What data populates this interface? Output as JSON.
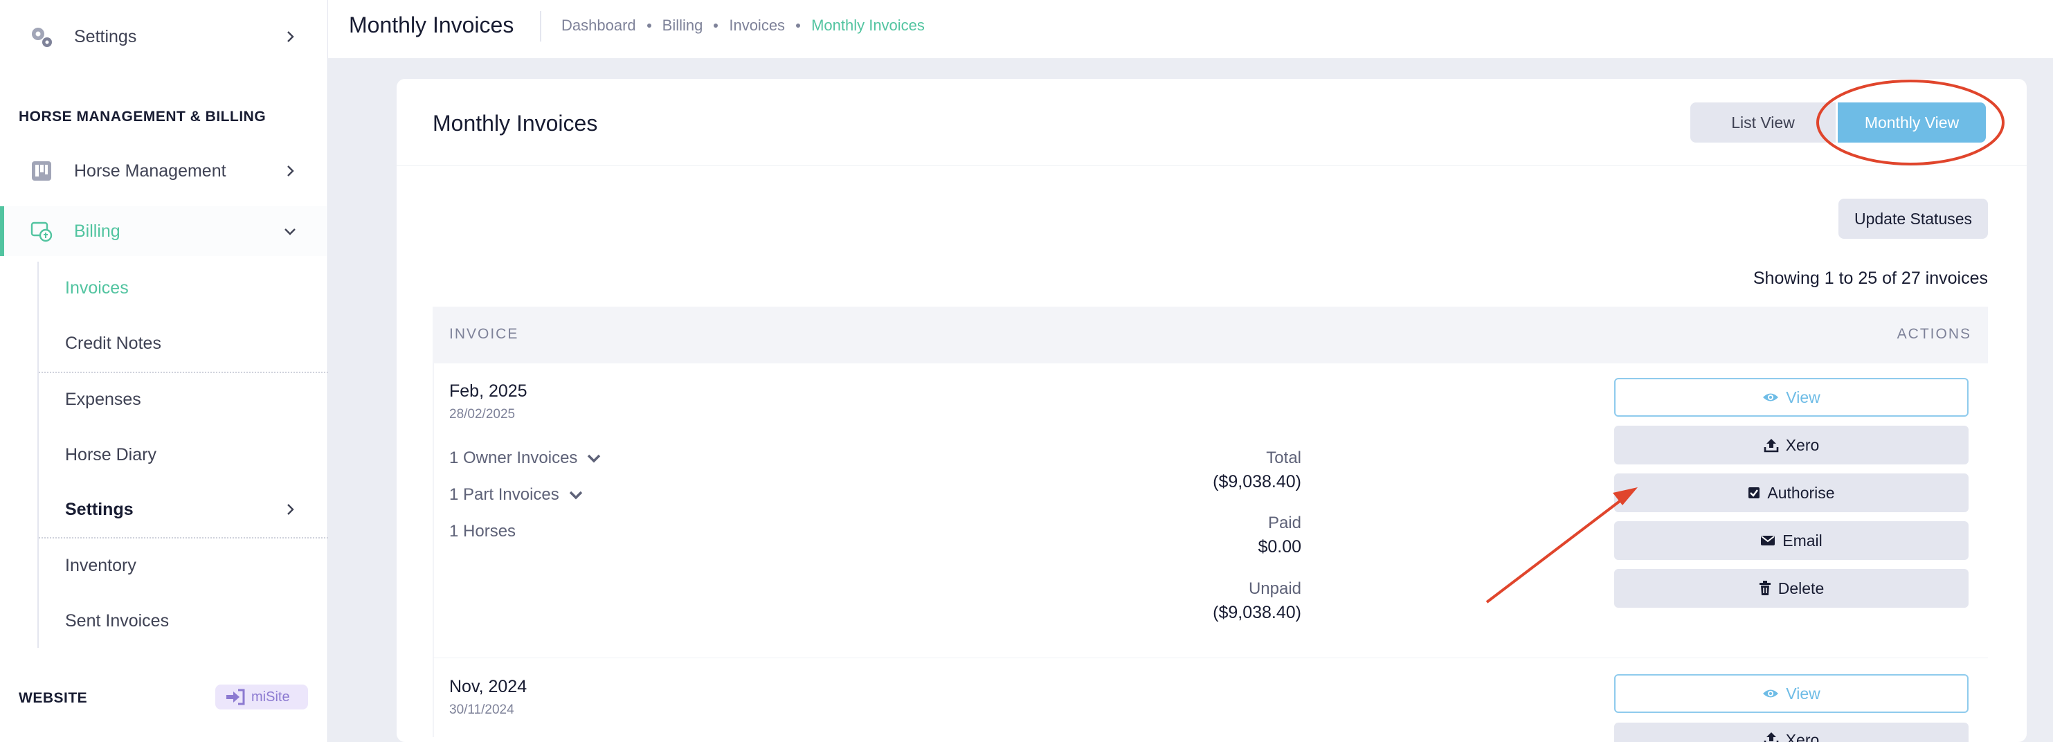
{
  "sidebar": {
    "settings_top": "Settings",
    "section_hmb": "HORSE MANAGEMENT & BILLING",
    "horse_management": "Horse Management",
    "billing": "Billing",
    "sub": {
      "invoices": "Invoices",
      "credit_notes": "Credit Notes",
      "expenses": "Expenses",
      "horse_diary": "Horse Diary",
      "settings": "Settings",
      "inventory": "Inventory",
      "sent_invoices": "Sent Invoices"
    },
    "section_website": "WEBSITE",
    "misite": "miSite"
  },
  "header": {
    "title": "Monthly Invoices",
    "breadcrumb": [
      "Dashboard",
      "Billing",
      "Invoices",
      "Monthly Invoices"
    ]
  },
  "card": {
    "title": "Monthly Invoices",
    "list_view": "List View",
    "monthly_view": "Monthly View",
    "update_statuses": "Update Statuses",
    "showing": "Showing 1 to 25 of 27 invoices",
    "col_invoice": "INVOICE",
    "col_actions": "ACTIONS"
  },
  "invoices": [
    {
      "month": "Feb, 2025",
      "date": "28/02/2025",
      "owner_invoices": "1 Owner Invoices",
      "part_invoices": "1 Part Invoices",
      "horses": "1 Horses",
      "total_label": "Total",
      "total": "($9,038.40)",
      "paid_label": "Paid",
      "paid": "$0.00",
      "unpaid_label": "Unpaid",
      "unpaid": "($9,038.40)",
      "actions": {
        "view": "View",
        "xero": "Xero",
        "authorise": "Authorise",
        "email": "Email",
        "delete": "Delete"
      }
    },
    {
      "month": "Nov, 2024",
      "date": "30/11/2024",
      "actions": {
        "view": "View",
        "xero": "Xero"
      }
    }
  ],
  "colors": {
    "accent_green": "#52c4a0",
    "primary_blue": "#6ebce6",
    "annotation_red": "#e0452c"
  }
}
